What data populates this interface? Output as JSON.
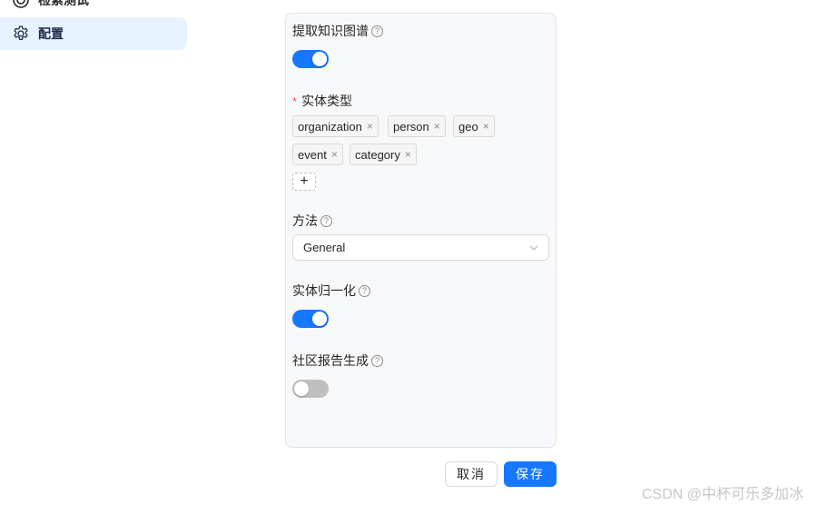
{
  "sidebar": {
    "items": [
      {
        "label": "检索测试",
        "icon": "target-icon"
      },
      {
        "label": "配置",
        "icon": "gear-icon",
        "active": true
      }
    ]
  },
  "form": {
    "knowledge_graph": {
      "label": "提取知识图谱",
      "help": "?",
      "enabled": true
    },
    "entity_types": {
      "label": "实体类型",
      "required_mark": "*",
      "tags": [
        "organization",
        "person",
        "geo",
        "event",
        "category"
      ],
      "tag_close": "×",
      "add_label": "+"
    },
    "method": {
      "label": "方法",
      "help": "?",
      "value": "General"
    },
    "entity_resolution": {
      "label": "实体归一化",
      "help": "?",
      "enabled": true
    },
    "community_report": {
      "label": "社区报告生成",
      "help": "?",
      "enabled": false
    }
  },
  "actions": {
    "cancel": "取消",
    "save": "保存"
  },
  "watermark": "CSDN @中杯可乐多加冰",
  "colors": {
    "primary": "#1677ff",
    "active_bg": "#e6f2ff",
    "required": "#ff4d4f"
  }
}
